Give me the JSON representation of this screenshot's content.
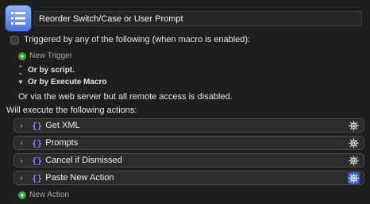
{
  "macro": {
    "title": "Reorder Switch/Case or User Prompt",
    "icon_name": "list-icon",
    "icon_color": "#5f86f0"
  },
  "triggers": {
    "heading": "Triggered by any of the following (when macro is enabled):",
    "new_trigger_label": "New Trigger",
    "by_script_label": "Or by script.",
    "by_execute_macro_label": "Or by Execute Macro",
    "web_server_note": "Or via the web server but all remote access is disabled."
  },
  "actions": {
    "heading": "Will execute the following actions:",
    "items": [
      {
        "label": "Get XML"
      },
      {
        "label": "Prompts"
      },
      {
        "label": "Cancel if Dismissed"
      },
      {
        "label": "Paste New Action"
      }
    ],
    "new_action_label": "New Action"
  },
  "colors": {
    "background": "#1e1e1e",
    "action_background": "#2c2c2c",
    "accent_purple": "#8b7cf6",
    "add_green": "#3fa33f",
    "selected_gear": "#3f5fb8"
  }
}
